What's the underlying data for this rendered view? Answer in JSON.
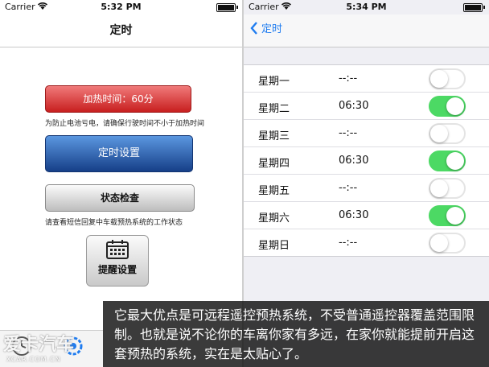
{
  "left_screen": {
    "status_bar": {
      "carrier": "Carrier",
      "time": "5:32 PM"
    },
    "nav_title": "定时",
    "heat_button_label": "加热时间：60分",
    "heat_note": "为防止电池亏电，请确保行驶时间不小于加热时间",
    "timer_button_label": "定时设置",
    "status_button_label": "状态检查",
    "status_note": "请查看短信回复中车载预热系统的工作状态",
    "remind_button_label": "提醒设置"
  },
  "right_screen": {
    "status_bar": {
      "carrier": "Carrier",
      "time": "5:34 PM"
    },
    "back_label": "定时",
    "schedule": [
      {
        "day": "星期一",
        "time": "--:--",
        "enabled": false
      },
      {
        "day": "星期二",
        "time": "06:30",
        "enabled": true
      },
      {
        "day": "星期三",
        "time": "--:--",
        "enabled": false
      },
      {
        "day": "星期四",
        "time": "06:30",
        "enabled": true
      },
      {
        "day": "星期五",
        "time": "--:--",
        "enabled": false
      },
      {
        "day": "星期六",
        "time": "06:30",
        "enabled": true
      },
      {
        "day": "星期日",
        "time": "--:--",
        "enabled": false
      }
    ]
  },
  "caption": {
    "text": "它最大优点是可远程遥控预热系统，不受普通遥控器覆盖范围限制。也就是说不论你的车离你家有多远，在家你就能提前开启这套预热的系统，实在是太贴心了。"
  },
  "watermark": {
    "main": "爱卡汽车",
    "sub": "XCAR.COM.CN"
  },
  "colors": {
    "ios_blue": "#1f7cf0",
    "switch_on": "#4cd964",
    "heat_red": "#c81f1f",
    "timer_blue": "#163f88"
  }
}
